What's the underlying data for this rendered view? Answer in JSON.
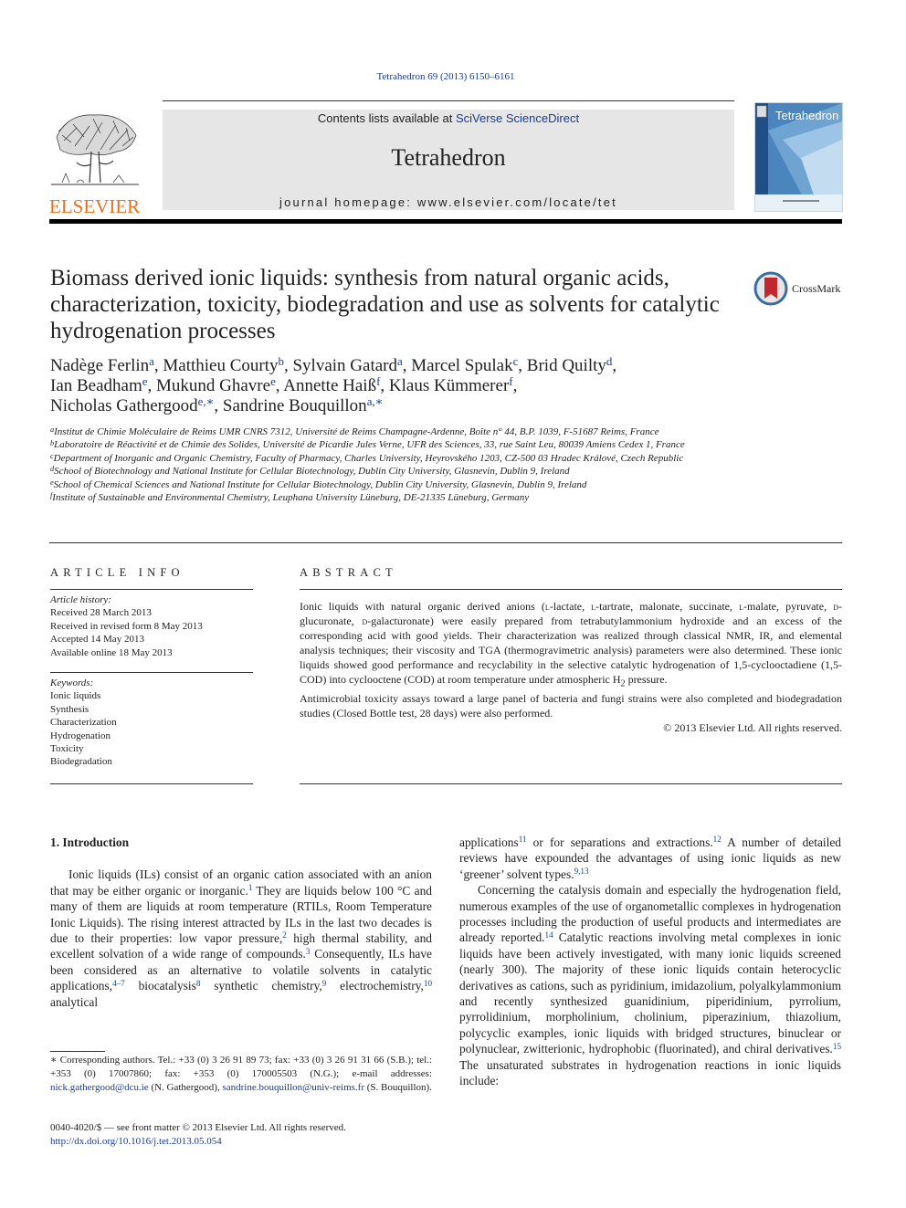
{
  "header": {
    "journal_ref": "Tetrahedron 69 (2013) 6150–6161",
    "contents_prefix": "Contents lists available at ",
    "contents_link": "SciVerse ScienceDirect",
    "journal_name": "Tetrahedron",
    "homepage_line": "journal homepage: www.elsevier.com/locate/tet",
    "publisher_logo_text": "ELSEVIER",
    "cover_title": "Tetrahedron",
    "publisher_color": "#e9711c",
    "link_color": "#1a3d8f"
  },
  "article": {
    "title": "Biomass derived ionic liquids: synthesis from natural organic acids, characterization, toxicity, biodegradation and use as solvents for catalytic hydrogenation processes",
    "crossmark_label": "CrossMark",
    "authors": [
      {
        "name": "Nadège Ferlin",
        "aff": "a",
        "sep": ", "
      },
      {
        "name": "Matthieu Courty",
        "aff": "b",
        "sep": ", "
      },
      {
        "name": "Sylvain Gatard",
        "aff": "a",
        "sep": ", "
      },
      {
        "name": "Marcel Spulak",
        "aff": "c",
        "sep": ", "
      },
      {
        "name": "Brid Quilty",
        "aff": "d",
        "sep": ","
      },
      {
        "name": "Ian Beadham",
        "aff": "e",
        "sep": ", "
      },
      {
        "name": "Mukund Ghavre",
        "aff": "e",
        "sep": ", "
      },
      {
        "name": "Annette Haiß",
        "aff": "f",
        "sep": ", "
      },
      {
        "name": "Klaus Kümmerer",
        "aff": "f",
        "sep": ","
      },
      {
        "name": "Nicholas Gathergood",
        "aff": "e,∗",
        "sep": ", "
      },
      {
        "name": "Sandrine Bouquillon",
        "aff": "a,∗",
        "sep": ""
      }
    ],
    "affiliations": [
      {
        "key": "a",
        "text": "Institut de Chimie Moléculaire de Reims UMR CNRS 7312, Université de Reims Champagne-Ardenne, Boîte n° 44, B.P. 1039, F-51687 Reims, France"
      },
      {
        "key": "b",
        "text": "Laboratoire de Réactivité et de Chimie des Solides, Université de Picardie Jules Verne, UFR des Sciences, 33, rue Saint Leu, 80039 Amiens Cedex 1, France"
      },
      {
        "key": "c",
        "text": "Department of Inorganic and Organic Chemistry, Faculty of Pharmacy, Charles University, Heyrovského 1203, CZ-500 03 Hradec Králové, Czech Republic"
      },
      {
        "key": "d",
        "text": "School of Biotechnology and National Institute for Cellular Biotechnology, Dublin City University, Glasnevin, Dublin 9, Ireland"
      },
      {
        "key": "e",
        "text": "School of Chemical Sciences and National Institute for Cellular Biotechnology, Dublin City University, Glasnevin, Dublin 9, Ireland"
      },
      {
        "key": "f",
        "text": "Institute of Sustainable and Environmental Chemistry, Leuphana University Lüneburg, DE-21335 Lüneburg, Germany"
      }
    ]
  },
  "article_info": {
    "heading": "ARTICLE INFO",
    "history_label": "Article history:",
    "history": [
      "Received 28 March 2013",
      "Received in revised form 8 May 2013",
      "Accepted 14 May 2013",
      "Available online 18 May 2013"
    ],
    "keywords_label": "Keywords:",
    "keywords": [
      "Ionic liquids",
      "Synthesis",
      "Characterization",
      "Hydrogenation",
      "Toxicity",
      "Biodegradation"
    ]
  },
  "abstract": {
    "heading": "ABSTRACT",
    "p1_a": "Ionic liquids with natural organic derived anions (",
    "p1_l1": "l",
    "p1_b": "-lactate, ",
    "p1_l2": "l",
    "p1_c": "-tartrate, malonate, succinate, ",
    "p1_l3": "l",
    "p1_d": "-malate, pyruvate, ",
    "p1_d1": "d",
    "p1_e": "-glucuronate, ",
    "p1_d2": "d",
    "p1_f": "-galacturonate) were easily prepared from tetrabutylammonium hydroxide and an excess of the corresponding acid with good yields. Their characterization was realized through classical NMR, IR, and elemental analysis techniques; their viscosity and TGA (thermogravimetric analysis) parameters were also determined. These ionic liquids showed good performance and recyclability in the selective catalytic hydrogenation of 1,5-cyclooctadiene (1,5-COD) into cyclooctene (COD) at room temperature under atmospheric H",
    "p1_sub": "2",
    "p1_g": " pressure.",
    "p2": "Antimicrobial toxicity assays toward a large panel of bacteria and fungi strains were also completed and biodegradation studies (Closed Bottle test, 28 days) were also performed.",
    "copyright": "© 2013 Elsevier Ltd. All rights reserved."
  },
  "introduction": {
    "heading": "1.  Introduction",
    "left": {
      "t1": "Ionic liquids (ILs) consist of an organic cation associated with an anion that may be either organic or inorganic.",
      "r1": "1",
      "t2": " They are liquids below 100 °C and many of them are liquids at room temperature (RTILs, Room Temperature Ionic Liquids). The rising interest attracted by ILs in the last two decades is due to their properties: low vapor pressure,",
      "r2": "2",
      "t3": " high thermal stability, and excellent solvation of a wide range of compounds.",
      "r3": "3",
      "t4": " Consequently, ILs have been considered as an alternative to volatile solvents in catalytic applications,",
      "r4": "4–7",
      "t5": " biocatalysis",
      "r5": "8",
      "t6": " synthetic chemistry,",
      "r6": "9",
      "t7": " electrochemistry,",
      "r7": "10",
      "t8": " analytical"
    },
    "right": {
      "t1": "applications",
      "r1": "11",
      "t2": " or for separations and extractions.",
      "r2": "12",
      "t3": " A number of detailed reviews have expounded the advantages of using ionic liquids as new ‘greener’ solvent types.",
      "r3": "9,13",
      "p2_t1": "Concerning the catalysis domain and especially the hydrogenation field, numerous examples of the use of organometallic complexes in hydrogenation processes including the production of useful products and intermediates are already reported.",
      "p2_r1": "14",
      "p2_t2": " Catalytic reactions involving metal complexes in ionic liquids have been actively investigated, with many ionic liquids screened (nearly 300). The majority of these ionic liquids contain heterocyclic derivatives as cations, such as pyridinium, imidazolium, polyalkylammonium and recently synthesized guanidinium, piperidinium, pyrrolium, pyrrolidinium, morpholinium, cholinium, piperazinium, thiazolium, polycyclic examples, ionic liquids with bridged structures, binuclear or polynuclear, zwitterionic, hydrophobic (fluorinated), and chiral derivatives.",
      "p2_r2": "15",
      "p2_t3": " The unsaturated substrates in hydrogenation reactions in ionic liquids include:"
    }
  },
  "footnote": {
    "t1": "∗ Corresponding authors. Tel.: +33 (0) 3 26 91 89 73; fax: +33 (0) 3 26 91 31 66 (S.B.); tel.: +353 (0) 17007860; fax: +353 (0) 170005503 (N.G.); e-mail addresses: ",
    "email1": "nick.gathergood@dcu.ie",
    "t2": " (N. Gathergood), ",
    "email2": "sandrine.bouquillon@univ-reims.fr",
    "t3": " (S. Bouquillon)."
  },
  "front_matter": {
    "issn_line": "0040-4020/$ — see front matter © 2013 Elsevier Ltd. All rights reserved.",
    "doi": "http://dx.doi.org/10.1016/j.tet.2013.05.054"
  }
}
